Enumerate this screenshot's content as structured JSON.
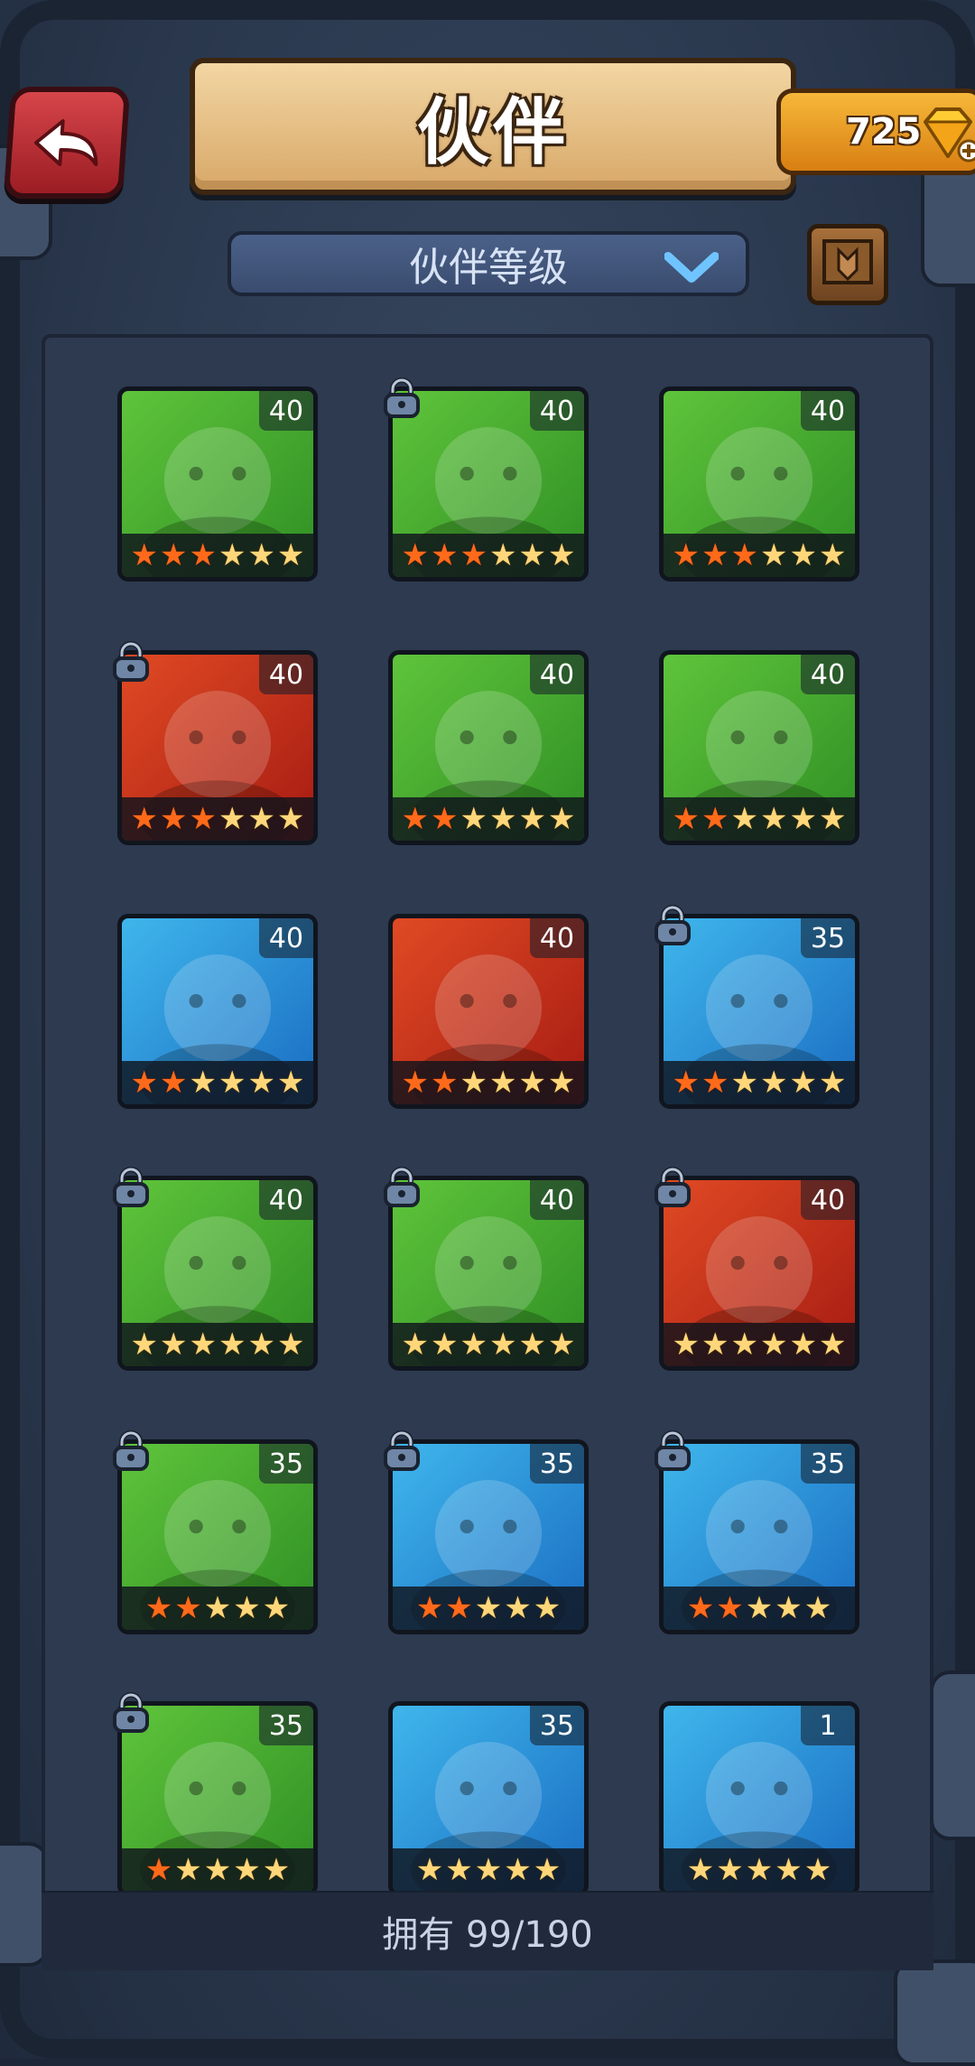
{
  "header": {
    "title": "伙伴",
    "gems": "725"
  },
  "sort": {
    "label": "伙伴等级"
  },
  "footer": {
    "owned": "拥有 99/190"
  },
  "colors": {
    "green": "#2f8f24",
    "red": "#a61b12",
    "blue": "#1a6dc2"
  },
  "partners": [
    {
      "level": "40",
      "color": "green",
      "stars_filled": 3,
      "stars_total": 6,
      "locked": false
    },
    {
      "level": "40",
      "color": "green",
      "stars_filled": 3,
      "stars_total": 6,
      "locked": true
    },
    {
      "level": "40",
      "color": "green",
      "stars_filled": 3,
      "stars_total": 6,
      "locked": false
    },
    {
      "level": "40",
      "color": "red",
      "stars_filled": 3,
      "stars_total": 6,
      "locked": true
    },
    {
      "level": "40",
      "color": "green",
      "stars_filled": 2,
      "stars_total": 6,
      "locked": false
    },
    {
      "level": "40",
      "color": "green",
      "stars_filled": 2,
      "stars_total": 6,
      "locked": false
    },
    {
      "level": "40",
      "color": "blue",
      "stars_filled": 2,
      "stars_total": 6,
      "locked": false
    },
    {
      "level": "40",
      "color": "red",
      "stars_filled": 2,
      "stars_total": 6,
      "locked": false
    },
    {
      "level": "35",
      "color": "blue",
      "stars_filled": 2,
      "stars_total": 6,
      "locked": true
    },
    {
      "level": "40",
      "color": "green",
      "stars_filled": 0,
      "stars_total": 6,
      "locked": true
    },
    {
      "level": "40",
      "color": "green",
      "stars_filled": 0,
      "stars_total": 6,
      "locked": true
    },
    {
      "level": "40",
      "color": "red",
      "stars_filled": 0,
      "stars_total": 6,
      "locked": true
    },
    {
      "level": "35",
      "color": "green",
      "stars_filled": 2,
      "stars_total": 5,
      "locked": true
    },
    {
      "level": "35",
      "color": "blue",
      "stars_filled": 2,
      "stars_total": 5,
      "locked": true
    },
    {
      "level": "35",
      "color": "blue",
      "stars_filled": 2,
      "stars_total": 5,
      "locked": true
    },
    {
      "level": "35",
      "color": "green",
      "stars_filled": 1,
      "stars_total": 5,
      "locked": true
    },
    {
      "level": "35",
      "color": "blue",
      "stars_filled": 0,
      "stars_total": 5,
      "locked": false
    },
    {
      "level": "1",
      "color": "blue",
      "stars_filled": 0,
      "stars_total": 5,
      "locked": false
    }
  ]
}
